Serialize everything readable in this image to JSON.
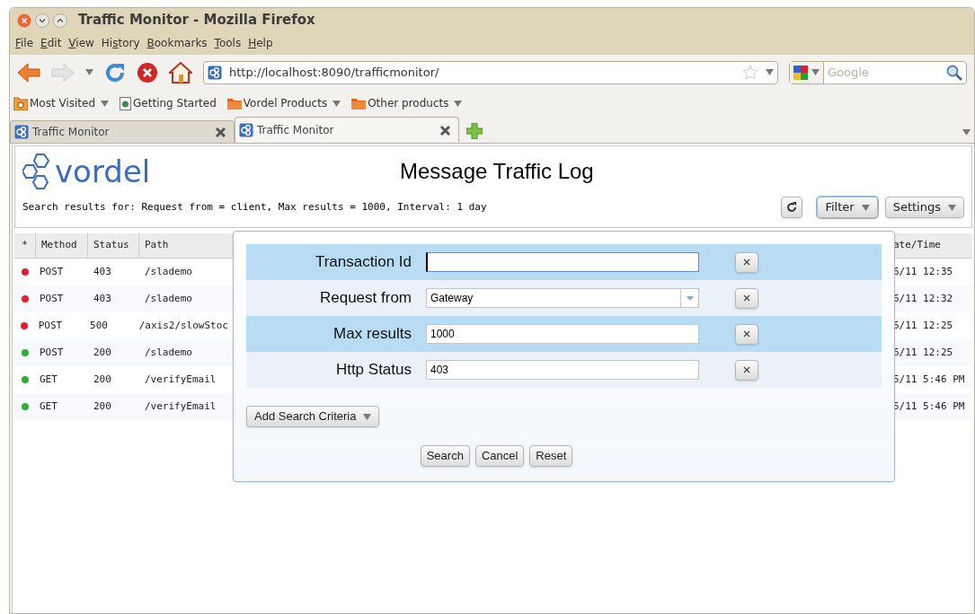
{
  "window": {
    "title": "Traffic Monitor - Mozilla Firefox"
  },
  "menu": [
    {
      "key": "F",
      "post": "ile"
    },
    {
      "key": "E",
      "post": "dit"
    },
    {
      "key": "V",
      "post": "iew"
    },
    {
      "pre": "Hi",
      "key": "s",
      "post": "tory"
    },
    {
      "key": "B",
      "post": "ookmarks"
    },
    {
      "key": "T",
      "post": "ools"
    },
    {
      "key": "H",
      "post": "elp"
    }
  ],
  "address": {
    "value": "http://localhost:8090/trafficmonitor/"
  },
  "search": {
    "placeholder": "Google"
  },
  "bookmarks": [
    {
      "label": "Most Visited",
      "kind": "smart",
      "menu": true
    },
    {
      "label": "Getting Started",
      "kind": "page",
      "menu": false
    },
    {
      "label": "Vordel Products",
      "kind": "folder",
      "menu": true
    },
    {
      "label": "Other products",
      "kind": "folder",
      "menu": true
    }
  ],
  "tabs": [
    {
      "label": "Traffic Monitor",
      "selected": false
    },
    {
      "label": "Traffic Monitor",
      "selected": true
    }
  ],
  "page": {
    "logo": "vordel",
    "title": "Message Traffic Log",
    "summary": "Search results for: Request from = client, Max results = 1000, Interval: 1 day",
    "buttons": [
      {
        "label": "Filter",
        "expanded": true
      },
      {
        "label": "Settings",
        "expanded": false
      }
    ]
  },
  "table": {
    "columns": [
      "*",
      "Method",
      "Status",
      "Path"
    ],
    "date_column": "ate/Time",
    "rows": [
      {
        "color": "#e02030",
        "method": "POST",
        "status": "403",
        "path": "/slademo",
        "date": "6/11 12:35"
      },
      {
        "color": "#e02030",
        "method": "POST",
        "status": "403",
        "path": "/slademo",
        "date": "6/11 12:32"
      },
      {
        "color": "#e02030",
        "method": "POST",
        "status": "500",
        "path": "/axis2/slowStoc",
        "date": "6/11 12:25"
      },
      {
        "color": "#30b030",
        "method": "POST",
        "status": "200",
        "path": "/slademo",
        "date": "6/11 12:25"
      },
      {
        "color": "#30b030",
        "method": "GET",
        "status": "200",
        "path": "/verifyEmail",
        "date": "5/11 5:46 PM"
      },
      {
        "color": "#30b030",
        "method": "GET",
        "status": "200",
        "path": "/verifyEmail",
        "date": "5/11 5:46 PM"
      }
    ]
  },
  "filter": {
    "criteria": [
      {
        "label": "Transaction Id",
        "kind": "text",
        "focused": true
      },
      {
        "label": "Request from",
        "kind": "select",
        "value": "Gateway",
        "focused": false
      },
      {
        "label": "Max results",
        "kind": "text",
        "value": "1000",
        "focused": false
      },
      {
        "label": "Http Status",
        "kind": "text",
        "value": "403",
        "focused": false
      }
    ],
    "add_button": "Add Search Criteria",
    "actions": [
      "Search",
      "Cancel",
      "Reset"
    ]
  }
}
